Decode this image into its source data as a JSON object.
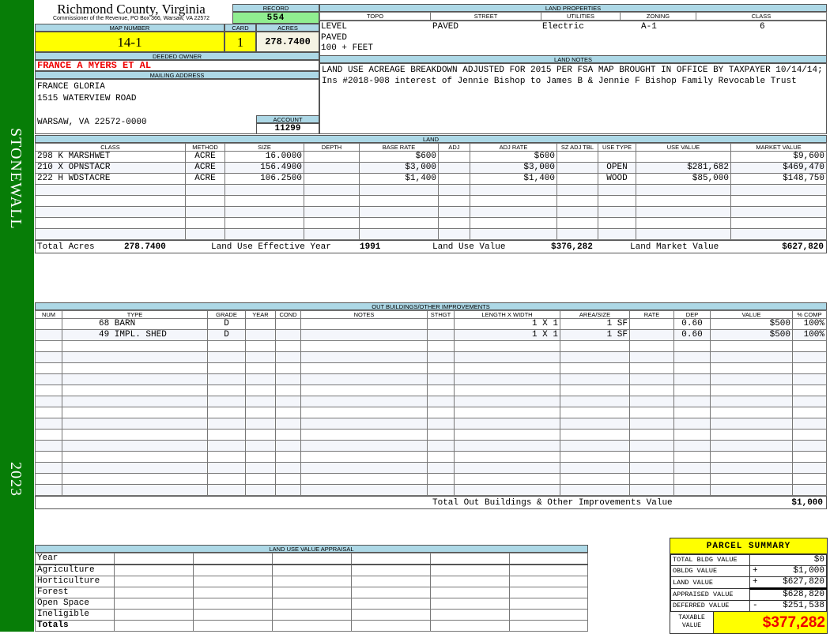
{
  "sidebar": {
    "district": "STONEWALL",
    "year": "2023",
    "color": "#077d07"
  },
  "header": {
    "county": "Richmond County, Virginia",
    "office": "Commissioner of the Revenue, PO Box 366, Warsaw, VA 22572"
  },
  "record": {
    "label": "RECORD",
    "value": "554"
  },
  "map": {
    "label": "MAP NUMBER",
    "value": "14-1"
  },
  "card": {
    "label": "CARD",
    "value": "1"
  },
  "acres": {
    "label": "ACRES",
    "value": "278.7400"
  },
  "owner": {
    "label": "DEEDED OWNER",
    "value": "FRANCE A MYERS ET AL"
  },
  "mailing": {
    "label": "MAILING ADDRESS",
    "lines": [
      "FRANCE GLORIA",
      "1515 WATERVIEW ROAD",
      "",
      "WARSAW, VA 22572-0000"
    ]
  },
  "account": {
    "label": "ACCOUNT",
    "value": "11299"
  },
  "land_properties": {
    "label": "LAND PROPERTIES",
    "columns": [
      "TOPO",
      "STREET",
      "UTILITIES",
      "ZONING",
      "CLASS"
    ],
    "street": "PAVED",
    "utilities": "Electric",
    "zoning": "A-1",
    "class": "6",
    "topo": [
      "LEVEL",
      "PAVED",
      "100 + FEET"
    ]
  },
  "land_notes": {
    "label": "LAND NOTES",
    "text": "LAND USE ACREAGE BREAKDOWN ADJUSTED FOR 2015 PER FSA MAP BROUGHT IN OFFICE BY TAXPAYER 10/14/14; Ins #2018-908 interest of Jennie Bishop to James B & Jennie F Bishop Family Revocable Trust"
  },
  "land": {
    "label": "LAND",
    "columns": [
      "CLASS",
      "METHOD",
      "SIZE",
      "DEPTH",
      "BASE RATE",
      "ADJ",
      "ADJ RATE",
      "SZ ADJ TBL",
      "USE TYPE",
      "USE VALUE",
      "MARKET VALUE"
    ],
    "rows": [
      [
        "298 K MARSHWET",
        "ACRE",
        "16.0000",
        "",
        "$600",
        "",
        "$600",
        "",
        "",
        "",
        "$9,600"
      ],
      [
        "210 X OPNSTACR",
        "ACRE",
        "156.4900",
        "",
        "$3,000",
        "",
        "$3,000",
        "",
        "OPEN",
        "$281,682",
        "$469,470"
      ],
      [
        "222 H WDSTACRE",
        "ACRE",
        "106.2500",
        "",
        "$1,400",
        "",
        "$1,400",
        "",
        "WOOD",
        "$85,000",
        "$148,750"
      ]
    ],
    "totals": {
      "acres_label": "Total Acres",
      "acres": "278.7400",
      "year_label": "Land Use Effective Year",
      "year": "1991",
      "use_label": "Land Use Value",
      "use": "$376,282",
      "market_label": "Land Market Value",
      "market": "$627,820"
    }
  },
  "outbuildings": {
    "label": "OUT BUILDINGS/OTHER IMPROVEMENTS",
    "columns": [
      "NUM",
      "TYPE",
      "GRADE",
      "YEAR",
      "COND",
      "NOTES",
      "STHGT",
      "LENGTH X WIDTH",
      "AREA/SIZE",
      "RATE",
      "DEP",
      "VALUE",
      "% COMP"
    ],
    "rows": [
      [
        "",
        "68 BARN",
        "D",
        "",
        "",
        "",
        "",
        "1 X 1",
        "1 SF",
        "",
        "0.60",
        "$500",
        "100%"
      ],
      [
        "",
        "49 IMPL. SHED",
        "D",
        "",
        "",
        "",
        "",
        "1 X 1",
        "1 SF",
        "",
        "0.60",
        "$500",
        "100%"
      ]
    ],
    "total_label": "Total Out Buildings & Other Improvements Value",
    "total": "$1,000"
  },
  "land_use_appraisal": {
    "label": "LAND USE VALUE APPRAISAL",
    "rows": [
      "Year",
      "Agriculture",
      "Horticulture",
      "Forest",
      "Open Space",
      "Ineligible",
      "Totals"
    ]
  },
  "parcel_summary": {
    "title": "PARCEL SUMMARY",
    "rows": [
      {
        "label": "TOTAL BLDG VALUE",
        "sign": "",
        "value": "$0"
      },
      {
        "label": "OBLDG VALUE",
        "sign": "+",
        "value": "$1,000"
      },
      {
        "label": "LAND VALUE",
        "sign": "+",
        "value": "$627,820"
      },
      {
        "label": "APPRAISED VALUE",
        "sign": "",
        "value": "$628,820"
      },
      {
        "label": "DEFERRED VALUE",
        "sign": "-",
        "value": "$251,538"
      }
    ],
    "taxable_label": "TAXABLE VALUE",
    "taxable": "$377,282"
  }
}
